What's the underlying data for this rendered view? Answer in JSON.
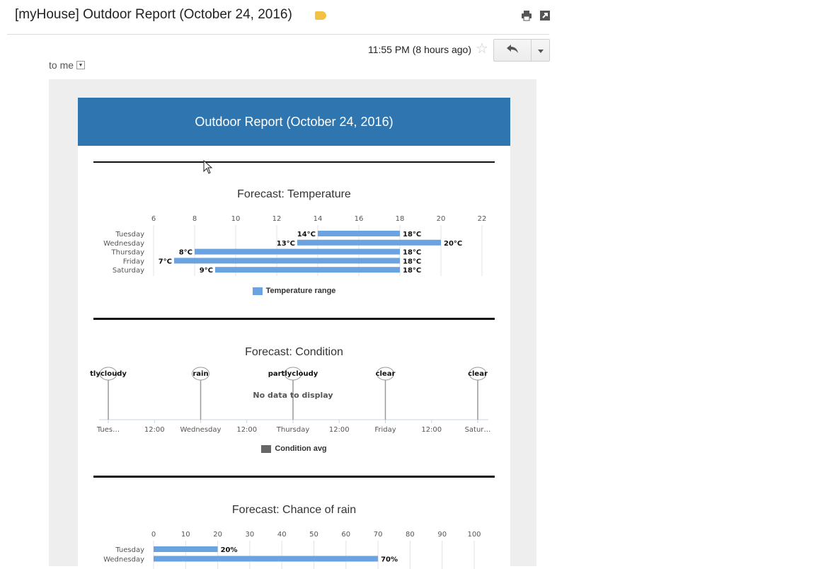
{
  "email": {
    "subject": "[myHouse] Outdoor Report (October 24, 2016)",
    "time": "11:55 PM (8 hours ago)",
    "recipient": "to me",
    "icons": [
      "print-icon",
      "new-window-icon",
      "label-icon",
      "star-icon",
      "reply-icon",
      "more-dropdown-icon"
    ]
  },
  "report": {
    "title": "Outdoor Report (October 24, 2016)",
    "banner_color": "#2f76b0"
  },
  "chart_data": [
    {
      "type": "bar",
      "orientation": "horizontal-range",
      "title": "Forecast: Temperature",
      "categories": [
        "Tuesday",
        "Wednesday",
        "Thursday",
        "Friday",
        "Saturday"
      ],
      "series": [
        {
          "name": "Temperature range",
          "low": [
            14,
            13,
            8,
            7,
            9
          ],
          "high": [
            18,
            20,
            18,
            18,
            18
          ]
        }
      ],
      "low_labels": [
        "14°C",
        "13°C",
        "8°C",
        "7°C",
        "9°C"
      ],
      "high_labels": [
        "18°C",
        "20°C",
        "18°C",
        "18°C",
        "18°C"
      ],
      "xlim": [
        6,
        22
      ],
      "xticks": [
        "6",
        "8",
        "10",
        "12",
        "14",
        "16",
        "18",
        "20",
        "22"
      ],
      "color": "#6aa3e0",
      "grid": true,
      "legend": "bottom"
    },
    {
      "type": "line",
      "title": "Forecast: Condition",
      "series": [
        {
          "name": "Condition avg",
          "values": []
        }
      ],
      "no_data_text": "No data to display",
      "xticks": [
        "Tues…",
        "12:00",
        "Wednesday",
        "12:00",
        "Thursday",
        "12:00",
        "Friday",
        "12:00",
        "Satur…"
      ],
      "flags": [
        {
          "day": "Tues…",
          "label": "tlycloudy"
        },
        {
          "day": "Wednesday",
          "label": "rain"
        },
        {
          "day": "Thursday",
          "label": "partlycloudy"
        },
        {
          "day": "Friday",
          "label": "clear"
        },
        {
          "day": "Satur…",
          "label": "clear"
        }
      ],
      "color": "#666666",
      "legend": "bottom"
    },
    {
      "type": "bar",
      "orientation": "horizontal",
      "title": "Forecast: Chance of rain",
      "categories": [
        "Tuesday",
        "Wednesday"
      ],
      "series": [
        {
          "values": [
            20,
            70
          ]
        }
      ],
      "value_labels": [
        "20%",
        "70%"
      ],
      "xlim": [
        0,
        100
      ],
      "xticks": [
        "0",
        "10",
        "20",
        "30",
        "40",
        "50",
        "60",
        "70",
        "80",
        "90",
        "100"
      ],
      "color": "#6aa3e0",
      "grid": true
    }
  ]
}
